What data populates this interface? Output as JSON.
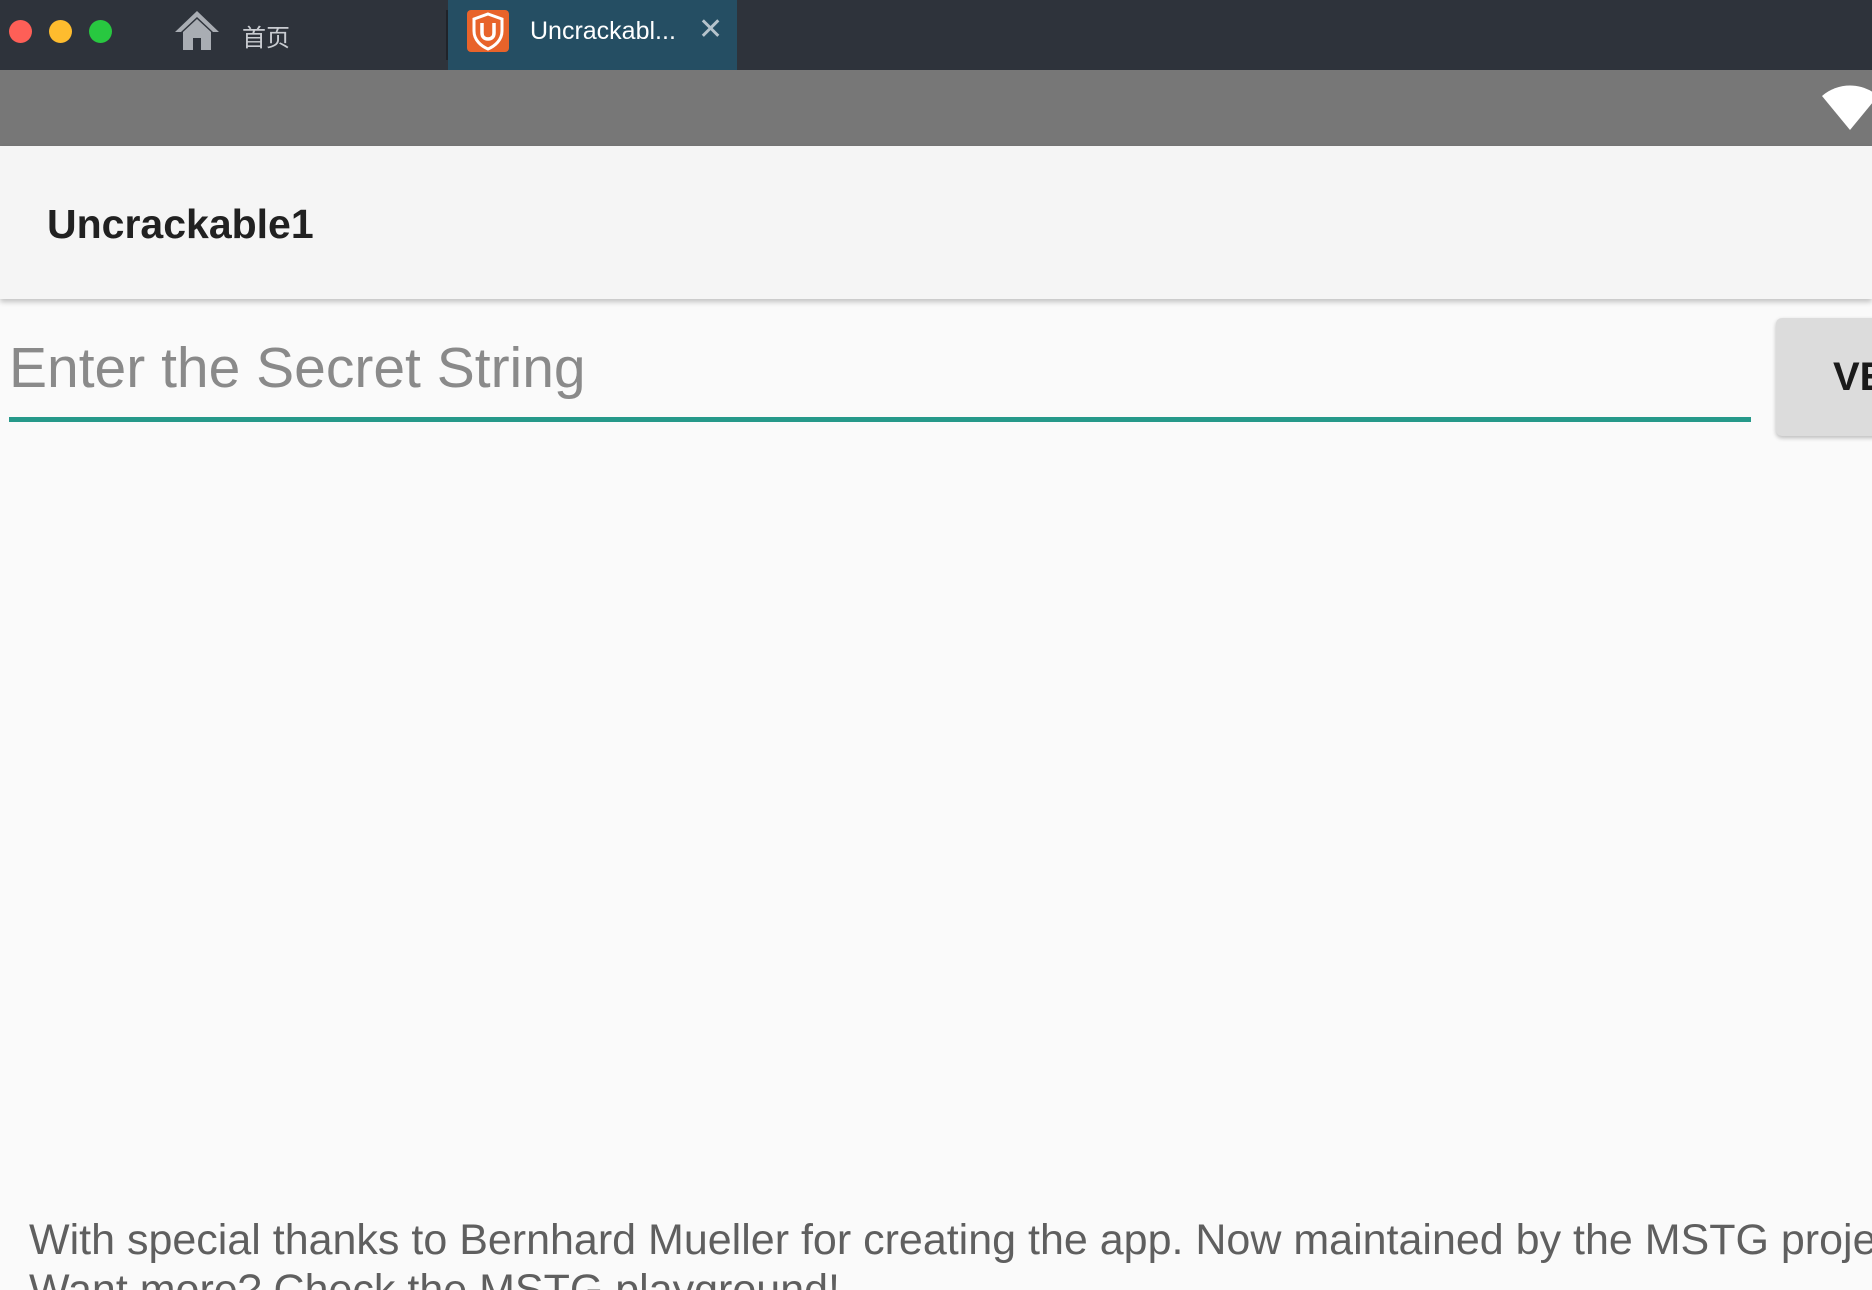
{
  "window": {
    "tabs": [
      {
        "label": "首页",
        "icon": "home-icon"
      },
      {
        "label": "Uncrackabl...",
        "icon": "shield-u-icon",
        "active": true,
        "close_glyph": "✕"
      }
    ]
  },
  "status_bar": {
    "icons": [
      "wifi-icon"
    ]
  },
  "app": {
    "title": "Uncrackable1",
    "secret_input": {
      "value": "",
      "placeholder": "Enter the Secret String"
    },
    "verify_button_label": "VE",
    "footer": {
      "line1": "With special thanks to Bernhard Mueller for creating the app. Now maintained by the MSTG proje",
      "line2": "Want more? Check the MSTG playground!"
    }
  },
  "colors": {
    "titlebar_bg": "#2e333b",
    "active_tab_bg": "#254e63",
    "status_bar_bg": "#777777",
    "action_bar_bg": "#f5f5f5",
    "accent": "#26998a",
    "shield_orange": "#e8632a"
  }
}
